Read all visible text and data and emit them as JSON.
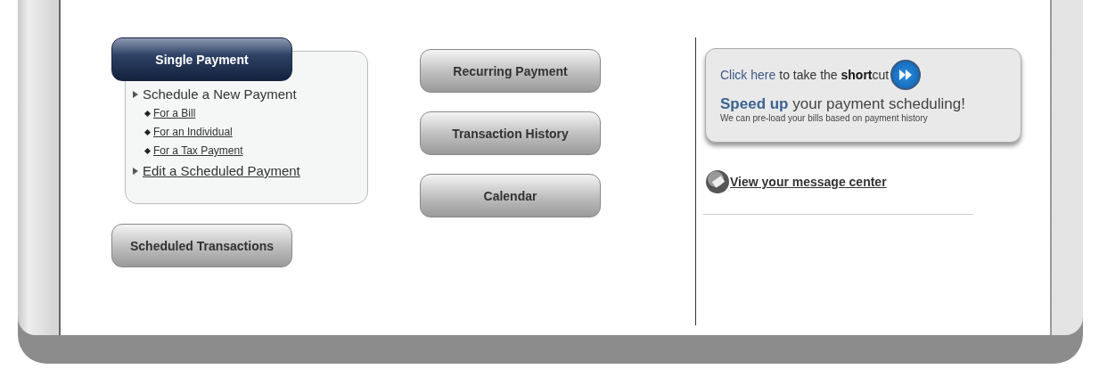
{
  "single_payment": {
    "tab": {
      "label": "Single Payment",
      "selected": true
    },
    "menu": [
      {
        "label": "Schedule a New Payment",
        "link": false,
        "children": [
          {
            "label": "For a Bill"
          },
          {
            "label": "For an Individual"
          },
          {
            "label": "For a Tax Payment"
          }
        ]
      },
      {
        "label": "Edit a Scheduled Payment",
        "link": true
      }
    ]
  },
  "left_buttons": [
    {
      "label": "Scheduled Transactions",
      "selected": false
    }
  ],
  "middle_buttons": [
    {
      "label": "Recurring Payment",
      "selected": false
    },
    {
      "label": "Transaction History",
      "selected": false
    },
    {
      "label": "Calendar",
      "selected": false
    }
  ],
  "shortcut": {
    "link": "Click here",
    "text": "to take the **short**cut",
    "headline_emphasis": "Speed up",
    "headline": "your payment scheduling!",
    "subtext": "We can pre-load your bills based on payment history"
  },
  "message_link": "View your message center"
}
